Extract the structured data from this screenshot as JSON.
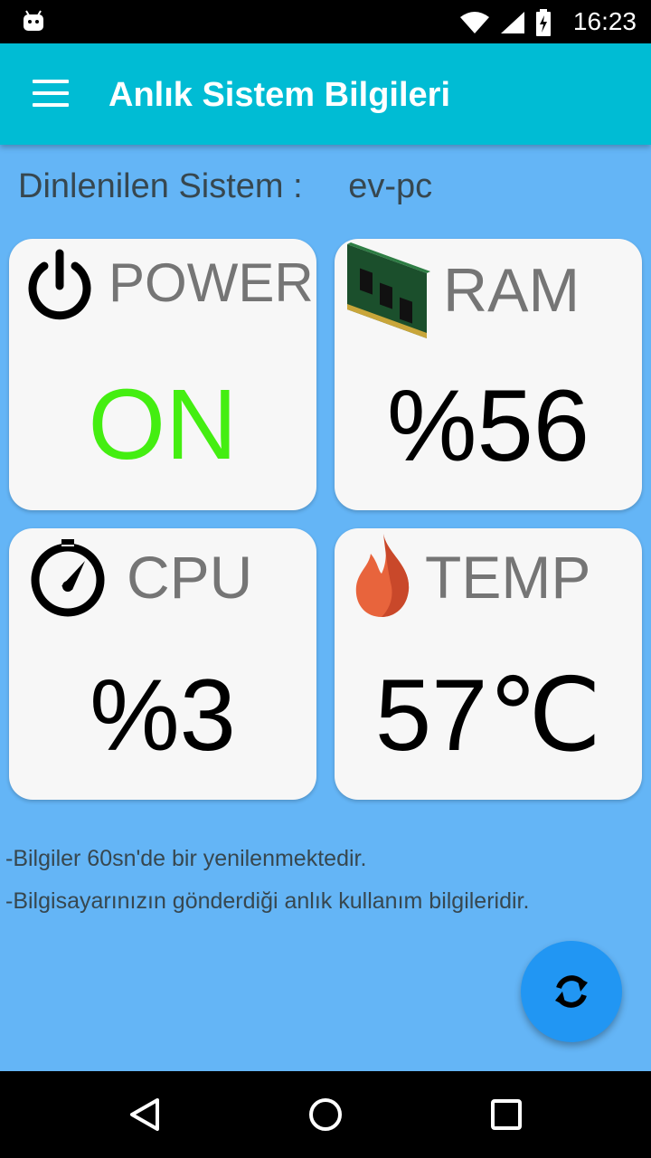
{
  "status_bar": {
    "time": "16:23",
    "icons": [
      "android-icon",
      "wifi-icon",
      "signal-icon",
      "battery-charging-icon"
    ]
  },
  "app_bar": {
    "title": "Anlık Sistem Bilgileri",
    "menu_icon": "menu-icon"
  },
  "system": {
    "label": "Dinlenilen Sistem :",
    "value": "ev-pc"
  },
  "cards": {
    "power": {
      "label": "POWER",
      "value": "ON",
      "icon": "power-icon",
      "value_color": "#44ee11"
    },
    "ram": {
      "label": "RAM",
      "value": "%56",
      "icon": "ram-module-icon"
    },
    "cpu": {
      "label": "CPU",
      "value": "%3",
      "icon": "gauge-icon"
    },
    "temp": {
      "label": "TEMP",
      "value": "57℃",
      "icon": "flame-icon"
    }
  },
  "notes": [
    "-Bilgiler 60sn'de bir yenilenmektedir.",
    "-Bilgisayarınızın gönderdiği anlık kullanım bilgileridir."
  ],
  "fab": {
    "icon": "refresh-icon"
  },
  "nav_bar": {
    "icons": [
      "back-icon",
      "home-icon",
      "recents-icon"
    ]
  },
  "colors": {
    "background": "#64b5f6",
    "app_bar": "#00bcd4",
    "fab": "#2196f3",
    "card": "#f7f7f7"
  }
}
